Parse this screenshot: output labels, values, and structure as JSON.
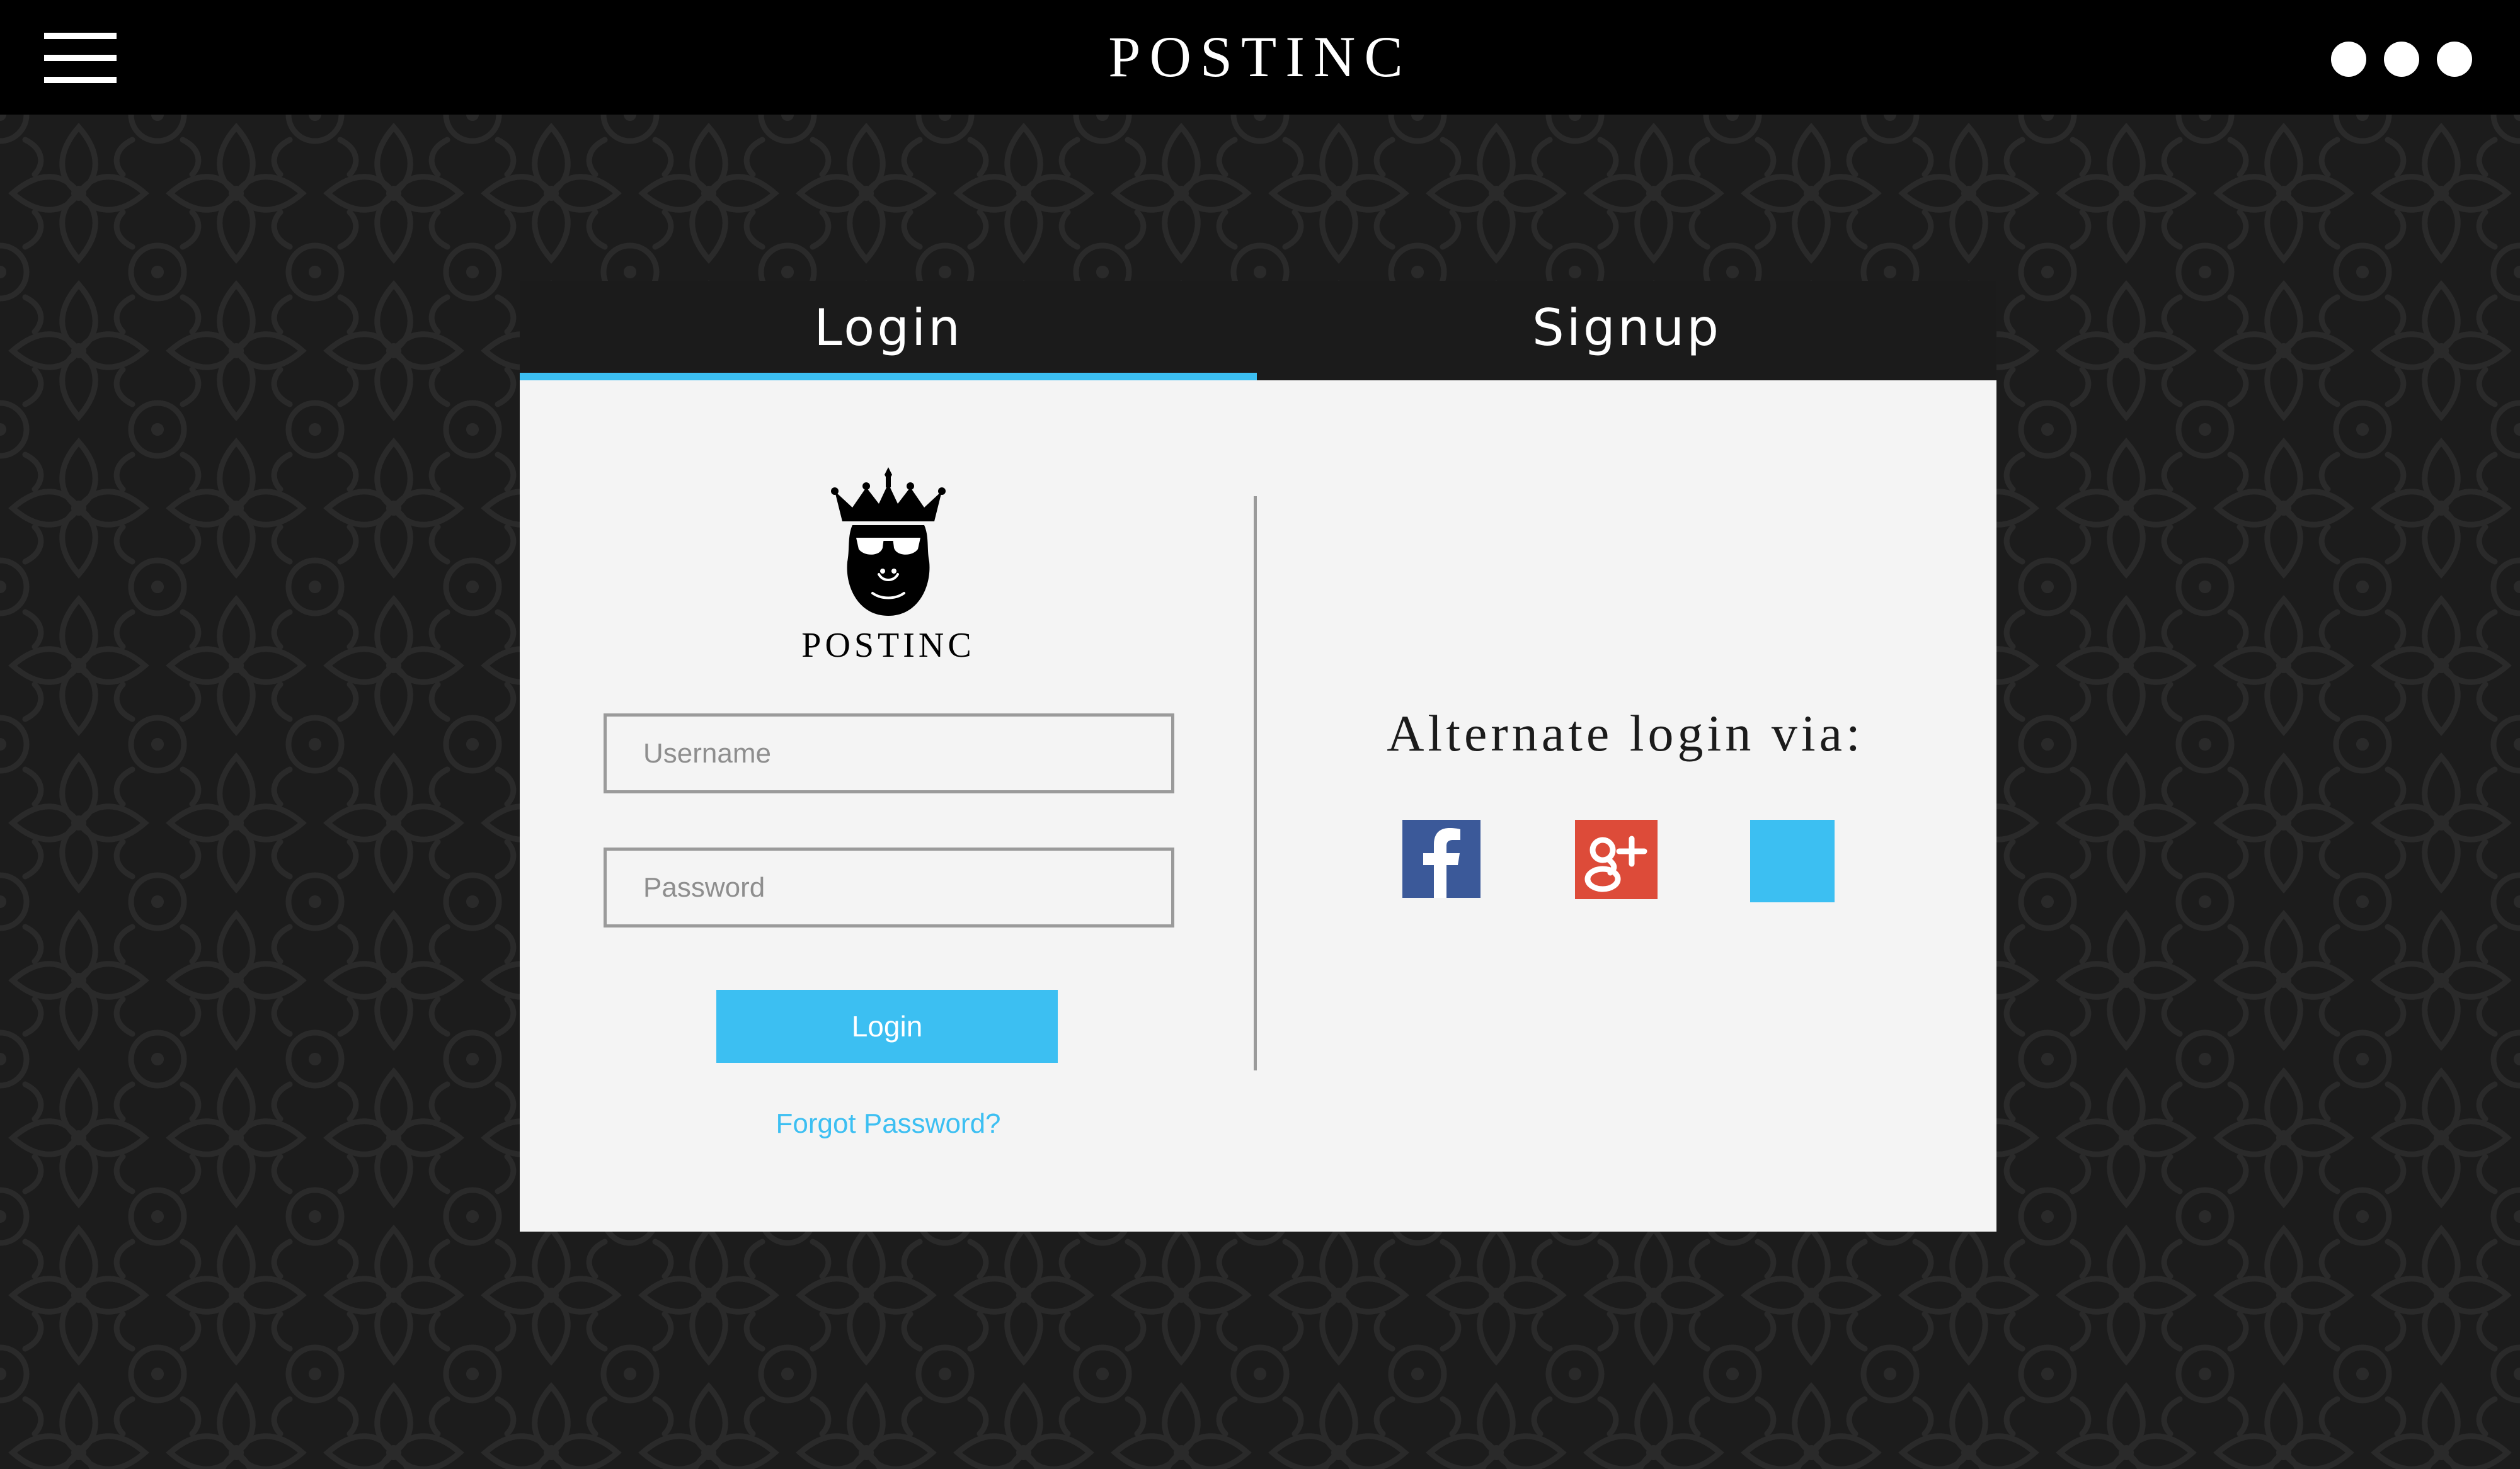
{
  "header": {
    "brand": "POSTINC",
    "menu_icon": "hamburger-menu-icon",
    "more_icon": "more-dots-icon"
  },
  "tabs": [
    {
      "label": "Login",
      "active": true
    },
    {
      "label": "Signup",
      "active": false
    }
  ],
  "login_form": {
    "logo_icon": "crowned-gorilla-logo",
    "logo_text": "POSTINC",
    "username_placeholder": "Username",
    "username_value": "",
    "password_placeholder": "Password",
    "password_value": "",
    "login_button_label": "Login",
    "forgot_password_label": "Forgot Password?"
  },
  "alternate_login": {
    "title": "Alternate login via:",
    "providers": [
      {
        "icon": "facebook-icon",
        "color": "#3b5999"
      },
      {
        "icon": "google-plus-icon",
        "color": "#dd4b39"
      },
      {
        "icon": "twitter-icon",
        "color": "#3cbff2"
      }
    ]
  },
  "colors": {
    "accent": "#3cbff2",
    "topbar": "#000000",
    "background": "#1c1c1c",
    "panel": "#f4f4f4",
    "tab_bar": "#1b1b1b"
  }
}
